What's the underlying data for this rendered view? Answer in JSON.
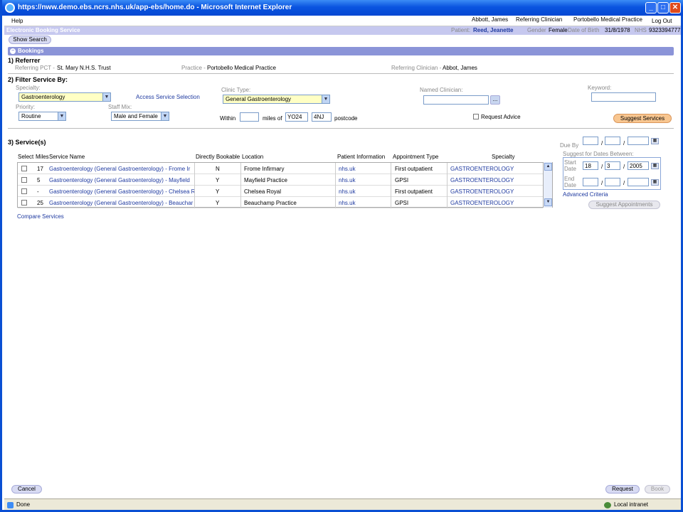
{
  "window": {
    "title": "https://nww.demo.ebs.ncrs.nhs.uk/app-ebs/home.do - Microsoft Internet Explorer"
  },
  "menu": {
    "help": "Help",
    "user": "Abbott, James",
    "role": "Referring Clinician",
    "practice": "Portobello Medical Practice",
    "logout": "Log Out"
  },
  "ebs": {
    "title": "Electronic Booking Service",
    "patient_label": "Patient:",
    "patient_name": "Reed, Jeanette",
    "gender_label": "Gender",
    "gender": "Female",
    "dob_label": "Date of Birth",
    "dob": "31/8/1978",
    "nhs_label": "NHS",
    "nhs": "9323394777"
  },
  "show_search": "Show Search",
  "bookings": "Bookings",
  "referrer": {
    "title": "1) Referrer",
    "pct_label": "Referring PCT -",
    "pct": "St. Mary N.H.S. Trust",
    "practice_label": "Practice -",
    "practice": "Portobello Medical Practice",
    "clinician_label": "Referring Clinician -",
    "clinician": "Abbot, James"
  },
  "filter": {
    "title": "2) Filter Service By:",
    "specialty_label": "Specialty:",
    "specialty": "Gastroenterology",
    "access_link": "Access Service Selection",
    "clinic_type_label": "Clinic Type:",
    "clinic_type": "General Gastroenterology",
    "named_clinician_label": "Named Clinician:",
    "keyword_label": "Keyword:",
    "priority_label": "Priority:",
    "priority": "Routine",
    "staff_mix_label": "Staff Mix:",
    "staff_mix": "Male and Female",
    "within": "Within",
    "miles_of": "miles of",
    "postcode1": "YO24",
    "postcode2": "4NJ",
    "postcode": "postcode",
    "request_advice": "Request Advice",
    "suggest": "Suggest Services",
    "ellipsis": "..."
  },
  "services": {
    "title": "3) Service(s)",
    "headers": {
      "select": "Select",
      "miles": "Miles",
      "name": "Service Name",
      "bookable": "Directly Bookable",
      "location": "Location",
      "info": "Patient Information",
      "appt": "Appointment Type",
      "specialty": "Specialty"
    },
    "rows": [
      {
        "miles": "17",
        "name": "Gastroenterology (General Gastroenterology) - Frome Ir",
        "bookable": "N",
        "location": "Frome Infirmary",
        "info": "nhs.uk",
        "appt": "First outpatient",
        "specialty": "GASTROENTEROLOGY"
      },
      {
        "miles": "5",
        "name": "Gastroenterology (General Gastroenterology) - Mayfield",
        "bookable": "Y",
        "location": "Mayfield Practice",
        "info": "nhs.uk",
        "appt": "GPSI",
        "specialty": "GASTROENTEROLOGY"
      },
      {
        "miles": "-",
        "name": "Gastroenterology (General Gastroenterology) - Chelsea R",
        "bookable": "Y",
        "location": "Chelsea Royal",
        "info": "nhs.uk",
        "appt": "First outpatient",
        "specialty": "GASTROENTEROLOGY"
      },
      {
        "miles": "25",
        "name": "Gastroenterology (General Gastroenterology) - Beauchar",
        "bookable": "Y",
        "location": "Beauchamp Practice",
        "info": "nhs.uk",
        "appt": "GPSI",
        "specialty": "GASTROENTEROLOGY"
      }
    ],
    "compare": "Compare Services"
  },
  "dates": {
    "due_by": "Due By",
    "slash": "/",
    "suggest_label": "Suggest for Dates Between:",
    "start": "Start Date",
    "start_d": "18",
    "start_m": "3",
    "start_y": "2005",
    "end": "End Date",
    "advanced": "Advanced Criteria",
    "suggest_appts": "Suggest Appointments"
  },
  "footer": {
    "cancel": "Cancel",
    "request": "Request",
    "book": "Book"
  },
  "status": {
    "done": "Done",
    "zone": "Local intranet"
  }
}
